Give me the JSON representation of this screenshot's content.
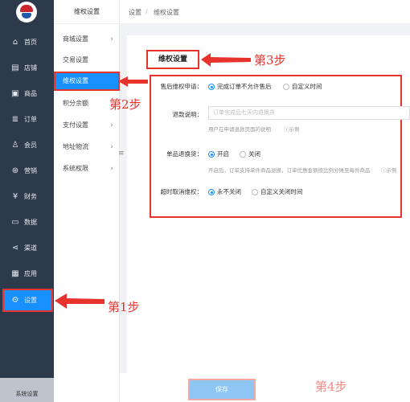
{
  "nav": {
    "items": [
      {
        "label": "首页",
        "icon": "home-icon",
        "glyph": "⌂"
      },
      {
        "label": "店铺",
        "icon": "store-icon",
        "glyph": "▤"
      },
      {
        "label": "商品",
        "icon": "goods-icon",
        "glyph": "▣"
      },
      {
        "label": "订单",
        "icon": "order-icon",
        "glyph": "≣"
      },
      {
        "label": "会员",
        "icon": "member-icon",
        "glyph": "♙"
      },
      {
        "label": "营销",
        "icon": "marketing-icon",
        "glyph": "⊛"
      },
      {
        "label": "财务",
        "icon": "finance-icon",
        "glyph": "¥"
      },
      {
        "label": "数据",
        "icon": "data-icon",
        "glyph": "▭"
      },
      {
        "label": "渠道",
        "icon": "channel-icon",
        "glyph": "⋖"
      },
      {
        "label": "应用",
        "icon": "apps-icon",
        "glyph": "▦"
      },
      {
        "label": "设置",
        "icon": "gear-icon",
        "glyph": "⚙"
      }
    ],
    "footer": "系统设置",
    "active_color": "#1890ff"
  },
  "subnav": {
    "title": "维权设置",
    "items": [
      {
        "label": "商城设置",
        "chevron": "›"
      },
      {
        "label": "交易设置",
        "chevron": ""
      },
      {
        "label": "维权设置",
        "chevron": ""
      },
      {
        "label": "积分余额",
        "chevron": ""
      },
      {
        "label": "支付设置",
        "chevron": "›"
      },
      {
        "label": "地址物流",
        "chevron": "›"
      },
      {
        "label": "系统权限",
        "chevron": "›"
      }
    ],
    "collapse_glyph": "≡"
  },
  "breadcrumb": {
    "root": "设置",
    "sep": "/",
    "current": "维权设置"
  },
  "section": {
    "title": "维权设置"
  },
  "form": {
    "after_sale": {
      "label": "售后维权申请：",
      "options": [
        "完成订单不允许售后",
        "自定义时间"
      ]
    },
    "refund_desc": {
      "label": "退款说明：",
      "placeholder": "订单完成后七天内退换货",
      "hint": "用户在申请退款页面的说明",
      "example": "ⓘ示例"
    },
    "single_refund": {
      "label": "单品退换货：",
      "options": [
        "开启",
        "关闭"
      ],
      "hint": "开启后，订单支持单件商品退换，订单优惠金额按比例分摊至每件商品",
      "example": "ⓘ示例"
    },
    "timeout": {
      "label": "超时取消维权：",
      "options": [
        "永不关闭",
        "自定义关闭时间"
      ]
    }
  },
  "annotations": {
    "step1": "第1步",
    "step2": "第2步",
    "step3": "第3步",
    "step4": "第4步",
    "color": "#e8322c"
  },
  "save": {
    "label": "保存"
  }
}
